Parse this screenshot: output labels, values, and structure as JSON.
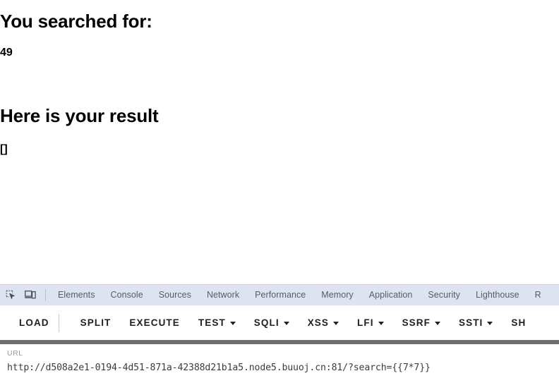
{
  "page": {
    "heading_searched": "You searched for:",
    "search_term": "49",
    "heading_result": "Here is your result",
    "result_value": "[]"
  },
  "devtools": {
    "icons": {
      "inspect": "inspect-element-icon",
      "device": "device-toolbar-icon"
    },
    "tabs": [
      {
        "label": "Elements"
      },
      {
        "label": "Console"
      },
      {
        "label": "Sources"
      },
      {
        "label": "Network"
      },
      {
        "label": "Performance"
      },
      {
        "label": "Memory"
      },
      {
        "label": "Application"
      },
      {
        "label": "Security"
      },
      {
        "label": "Lighthouse"
      },
      {
        "label": "R"
      }
    ],
    "actions": [
      {
        "label": "LOAD",
        "caret": false
      },
      {
        "label": "SPLIT",
        "caret": false
      },
      {
        "label": "EXECUTE",
        "caret": false
      },
      {
        "label": "TEST",
        "caret": true
      },
      {
        "label": "SQLI",
        "caret": true
      },
      {
        "label": "XSS",
        "caret": true
      },
      {
        "label": "LFI",
        "caret": true
      },
      {
        "label": "SSRF",
        "caret": true
      },
      {
        "label": "SSTI",
        "caret": true
      },
      {
        "label": "SH",
        "caret": false
      }
    ],
    "url_panel": {
      "label": "URL",
      "value": "http://d508a2e1-0194-4d51-871a-42388d21b1a5.node5.buuoj.cn:81/?search={{7*7}}"
    }
  },
  "colors": {
    "tabbar_background": "#dde3f0",
    "tab_text": "#585c66",
    "separator_band": "#6e6e6e",
    "url_text": "#3c3c3c",
    "url_label": "#9a9a9a",
    "page_text": "#000000"
  }
}
